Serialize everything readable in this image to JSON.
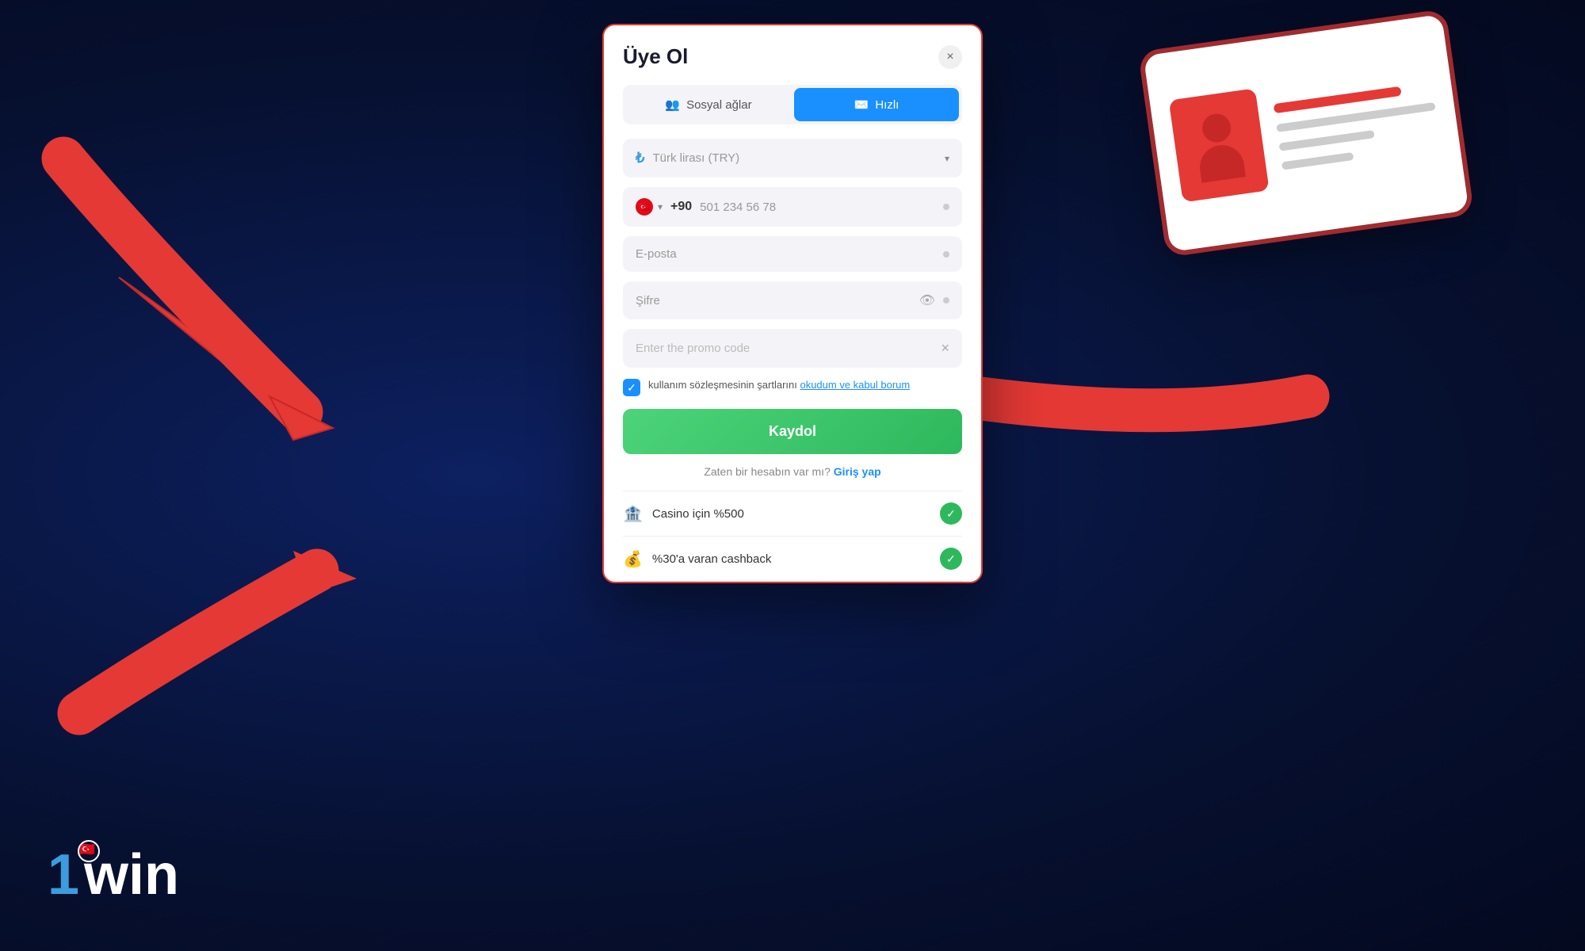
{
  "background": {
    "color": "#061030"
  },
  "logo": {
    "text": "1win",
    "number_part": "1",
    "win_part": "win"
  },
  "modal": {
    "title": "Üye Ol",
    "close_label": "×",
    "tabs": [
      {
        "id": "social",
        "label": "Sosyal ağlar",
        "active": false
      },
      {
        "id": "fast",
        "label": "Hızlı",
        "active": true
      }
    ],
    "currency_field": {
      "value": "Türk lirası (TRY)",
      "icon": "₺"
    },
    "phone_field": {
      "country_code": "+90",
      "placeholder": "501 234 56 78"
    },
    "email_field": {
      "placeholder": "E-posta"
    },
    "password_field": {
      "placeholder": "Şifre"
    },
    "promo_field": {
      "placeholder": "Enter the promo code"
    },
    "terms_text": "kullanım sözleşmesinin şartlarını ",
    "terms_link": "okudum ve kabul borum",
    "register_button": "Kaydol",
    "login_text": "Zaten bir hesabın var mı?",
    "login_link": "Giriş yap",
    "bonuses": [
      {
        "icon": "🏦",
        "text": "Casino için %500"
      },
      {
        "icon": "💰",
        "text": "%30'a varan cashback"
      }
    ]
  }
}
